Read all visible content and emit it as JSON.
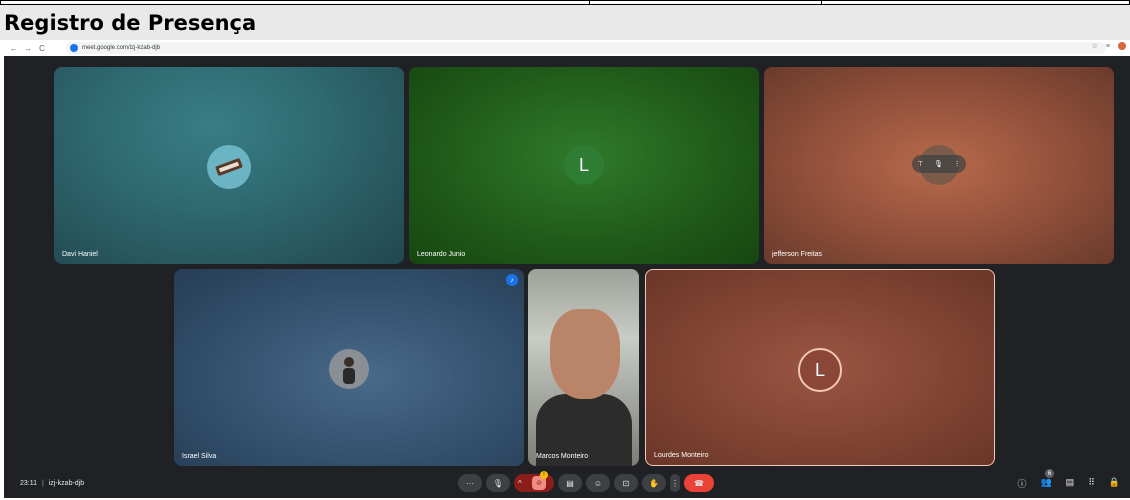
{
  "document": {
    "title": "Registro de Presença"
  },
  "browser": {
    "back": "←",
    "forward": "→",
    "reload": "C",
    "url": "meet.google.com/izj-kzab-djb",
    "star": "☆",
    "tabs_icon": "≡"
  },
  "participants": [
    {
      "name": "Davi Haniel",
      "avatar": "keyboard-icon"
    },
    {
      "name": "Leonardo Junio",
      "initial": "L"
    },
    {
      "name": "jefferson Freitas",
      "avatar": "photo"
    },
    {
      "name": "Israel Silva",
      "avatar": "photo"
    },
    {
      "name": "Marcos Monteiro",
      "avatar": "video"
    },
    {
      "name": "Lourdes Monteiro",
      "initial": "L"
    }
  ],
  "hover_controls": {
    "pin": "⊤",
    "mic": "🎙",
    "more": "⋮"
  },
  "bottom_bar": {
    "time": "23:11",
    "separator": "|",
    "meeting_code": "izj-kzab-djb",
    "more_options": "···",
    "mic": "🎙",
    "up_arrow": "^",
    "camera_off": "⊘",
    "warning": "!",
    "captions": "▤",
    "emoji": "☺",
    "present": "⊡",
    "raise_hand": "✋",
    "more": "⋮",
    "hang_up": "☎",
    "info": "ⓘ",
    "people": "👥",
    "people_count": "6",
    "chat": "▤",
    "activities": "⠿",
    "host_controls": "🔒"
  },
  "colors": {
    "meet_bg": "#202124",
    "hang_up": "#ea4335",
    "cam_off": "#8c1d18",
    "speaking": "#1a73e8"
  }
}
